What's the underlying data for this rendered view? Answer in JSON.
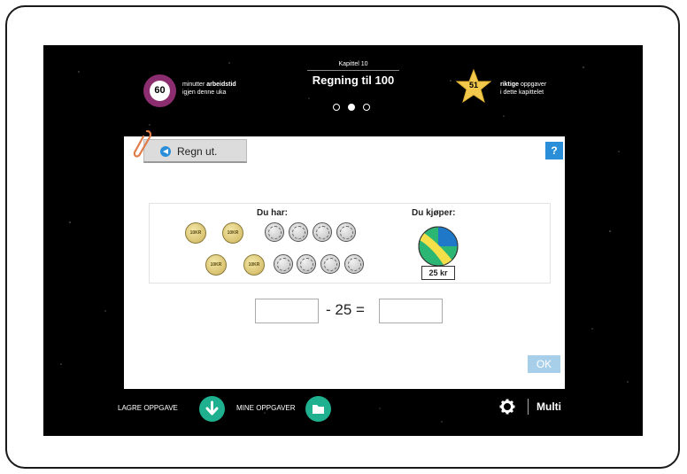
{
  "timer": {
    "value": "60",
    "line1_pre": "minutter ",
    "line1_bold": "arbeidstid",
    "line2": "igjen denne uka"
  },
  "chapter": {
    "label": "Kapittel 10",
    "title": "Regning til 100",
    "pages": 3,
    "active_page": 2
  },
  "score": {
    "value": "51",
    "line1_bold": "riktige",
    "line1_post": " oppgaver",
    "line2": "i dette kapittelet"
  },
  "task": {
    "read_button": "Regn ut.",
    "help": "?",
    "du_har": "Du har:",
    "du_kjoper": "Du kjøper:",
    "coin10_label": "10KR",
    "coin1_label": "KRONE",
    "price": "25 kr"
  },
  "equation": {
    "operator": "- 25 =",
    "input1_value": "",
    "input2_value": ""
  },
  "ok_label": "OK",
  "bottom": {
    "save_label": "LAGRE OPPGAVE",
    "my_tasks_label": "MINE OPPGAVER",
    "brand": "Multi"
  },
  "colors": {
    "accent_blue": "#2a8fd8",
    "timer_purple": "#8b2d6e",
    "green": "#1fb18f",
    "star_yellow": "#f2c94c"
  }
}
